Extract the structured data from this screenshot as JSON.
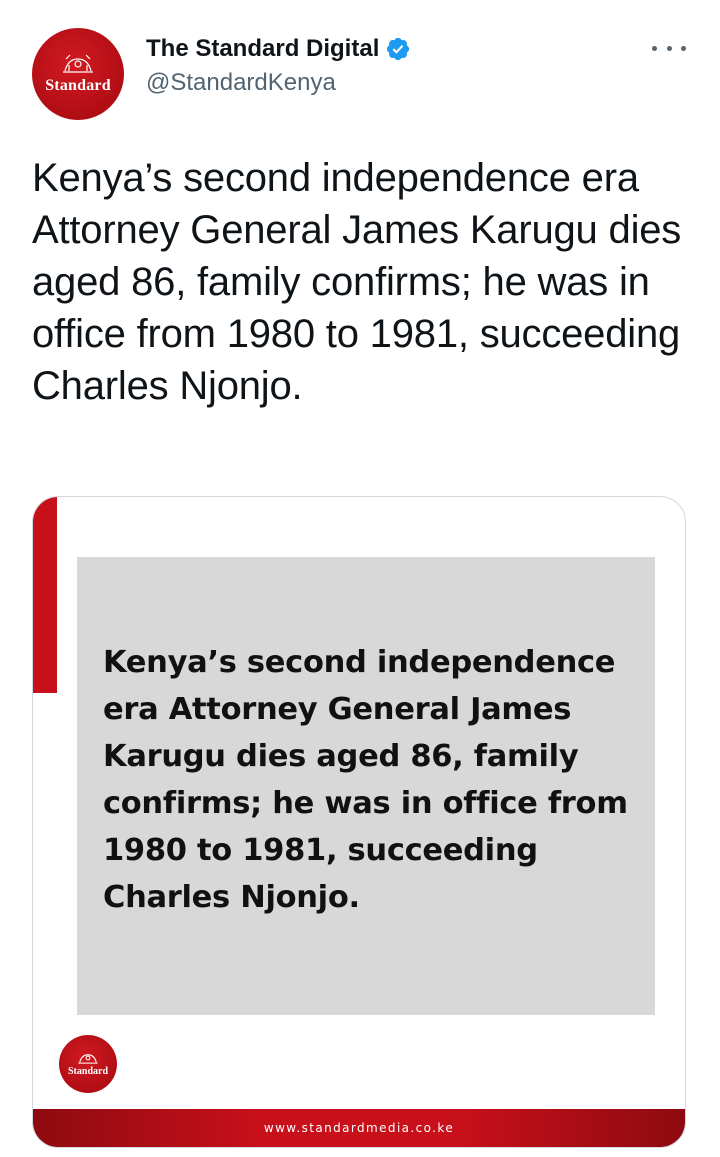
{
  "account": {
    "display_name": "The Standard Digital",
    "handle": "@StandardKenya",
    "avatar_text": "Standard",
    "verified": true
  },
  "tweet": {
    "text": "Kenya’s second independence era Attorney General James Karugu dies aged 86, family confirms; he was in office from 1980 to 1981, succeeding Charles Njonjo."
  },
  "media_card": {
    "headline": "Kenya’s second independence era Attorney General James Karugu dies aged 86, family confirms; he was in office from 1980 to 1981, succeeding Charles Njonjo.",
    "logo_text": "Standard",
    "footer_url": "www.standardmedia.co.ke"
  },
  "icons": {
    "more": "more-options-icon",
    "verified": "verified-badge-icon",
    "crest": "crest-icon"
  },
  "colors": {
    "brand_red": "#c8101a",
    "verified_blue": "#1d9bf0",
    "text_primary": "#0f1419",
    "text_secondary": "#536471",
    "card_gray": "#d8d8d8"
  }
}
